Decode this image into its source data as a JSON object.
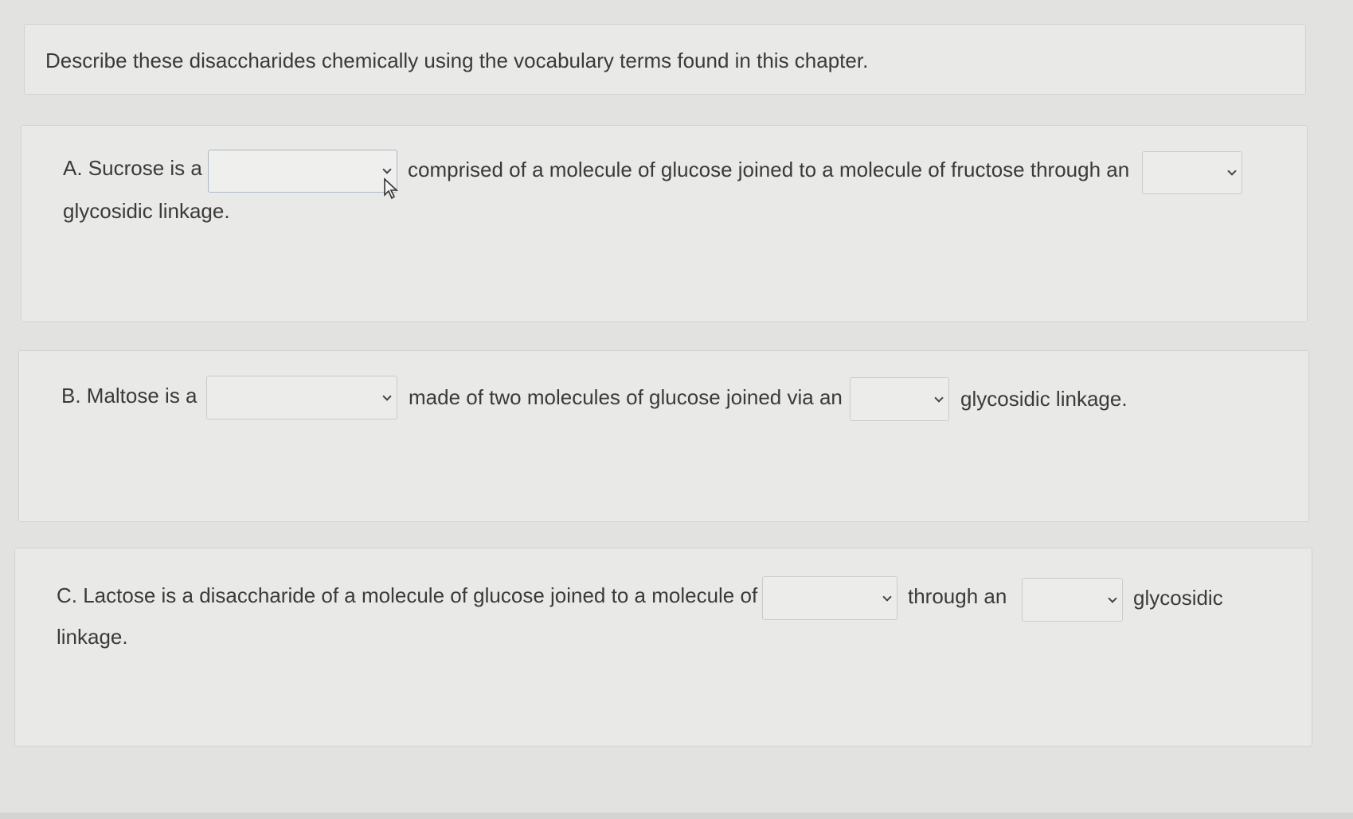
{
  "intro": {
    "text": "Describe these disaccharides chemically using the vocabulary terms found in this chapter."
  },
  "question_a": {
    "part1": "A. Sucrose is a",
    "part2": "comprised of a molecule of glucose joined to a molecule of fructose through an",
    "part3": "glycosidic linkage.",
    "select1_value": "",
    "select2_value": ""
  },
  "question_b": {
    "part1": "B. Maltose is a",
    "part2": "made of two molecules of glucose joined via an",
    "part3": "glycosidic linkage.",
    "select1_value": "",
    "select2_value": ""
  },
  "question_c": {
    "part1": "C. Lactose is a disaccharide of a molecule of glucose joined to a molecule of",
    "part2": "through an",
    "part3": "glycosidic",
    "part4": "linkage.",
    "select1_value": "",
    "select2_value": ""
  },
  "icons": {
    "dropdown": "chevron-down-icon",
    "cursor": "mouse-pointer-icon"
  }
}
